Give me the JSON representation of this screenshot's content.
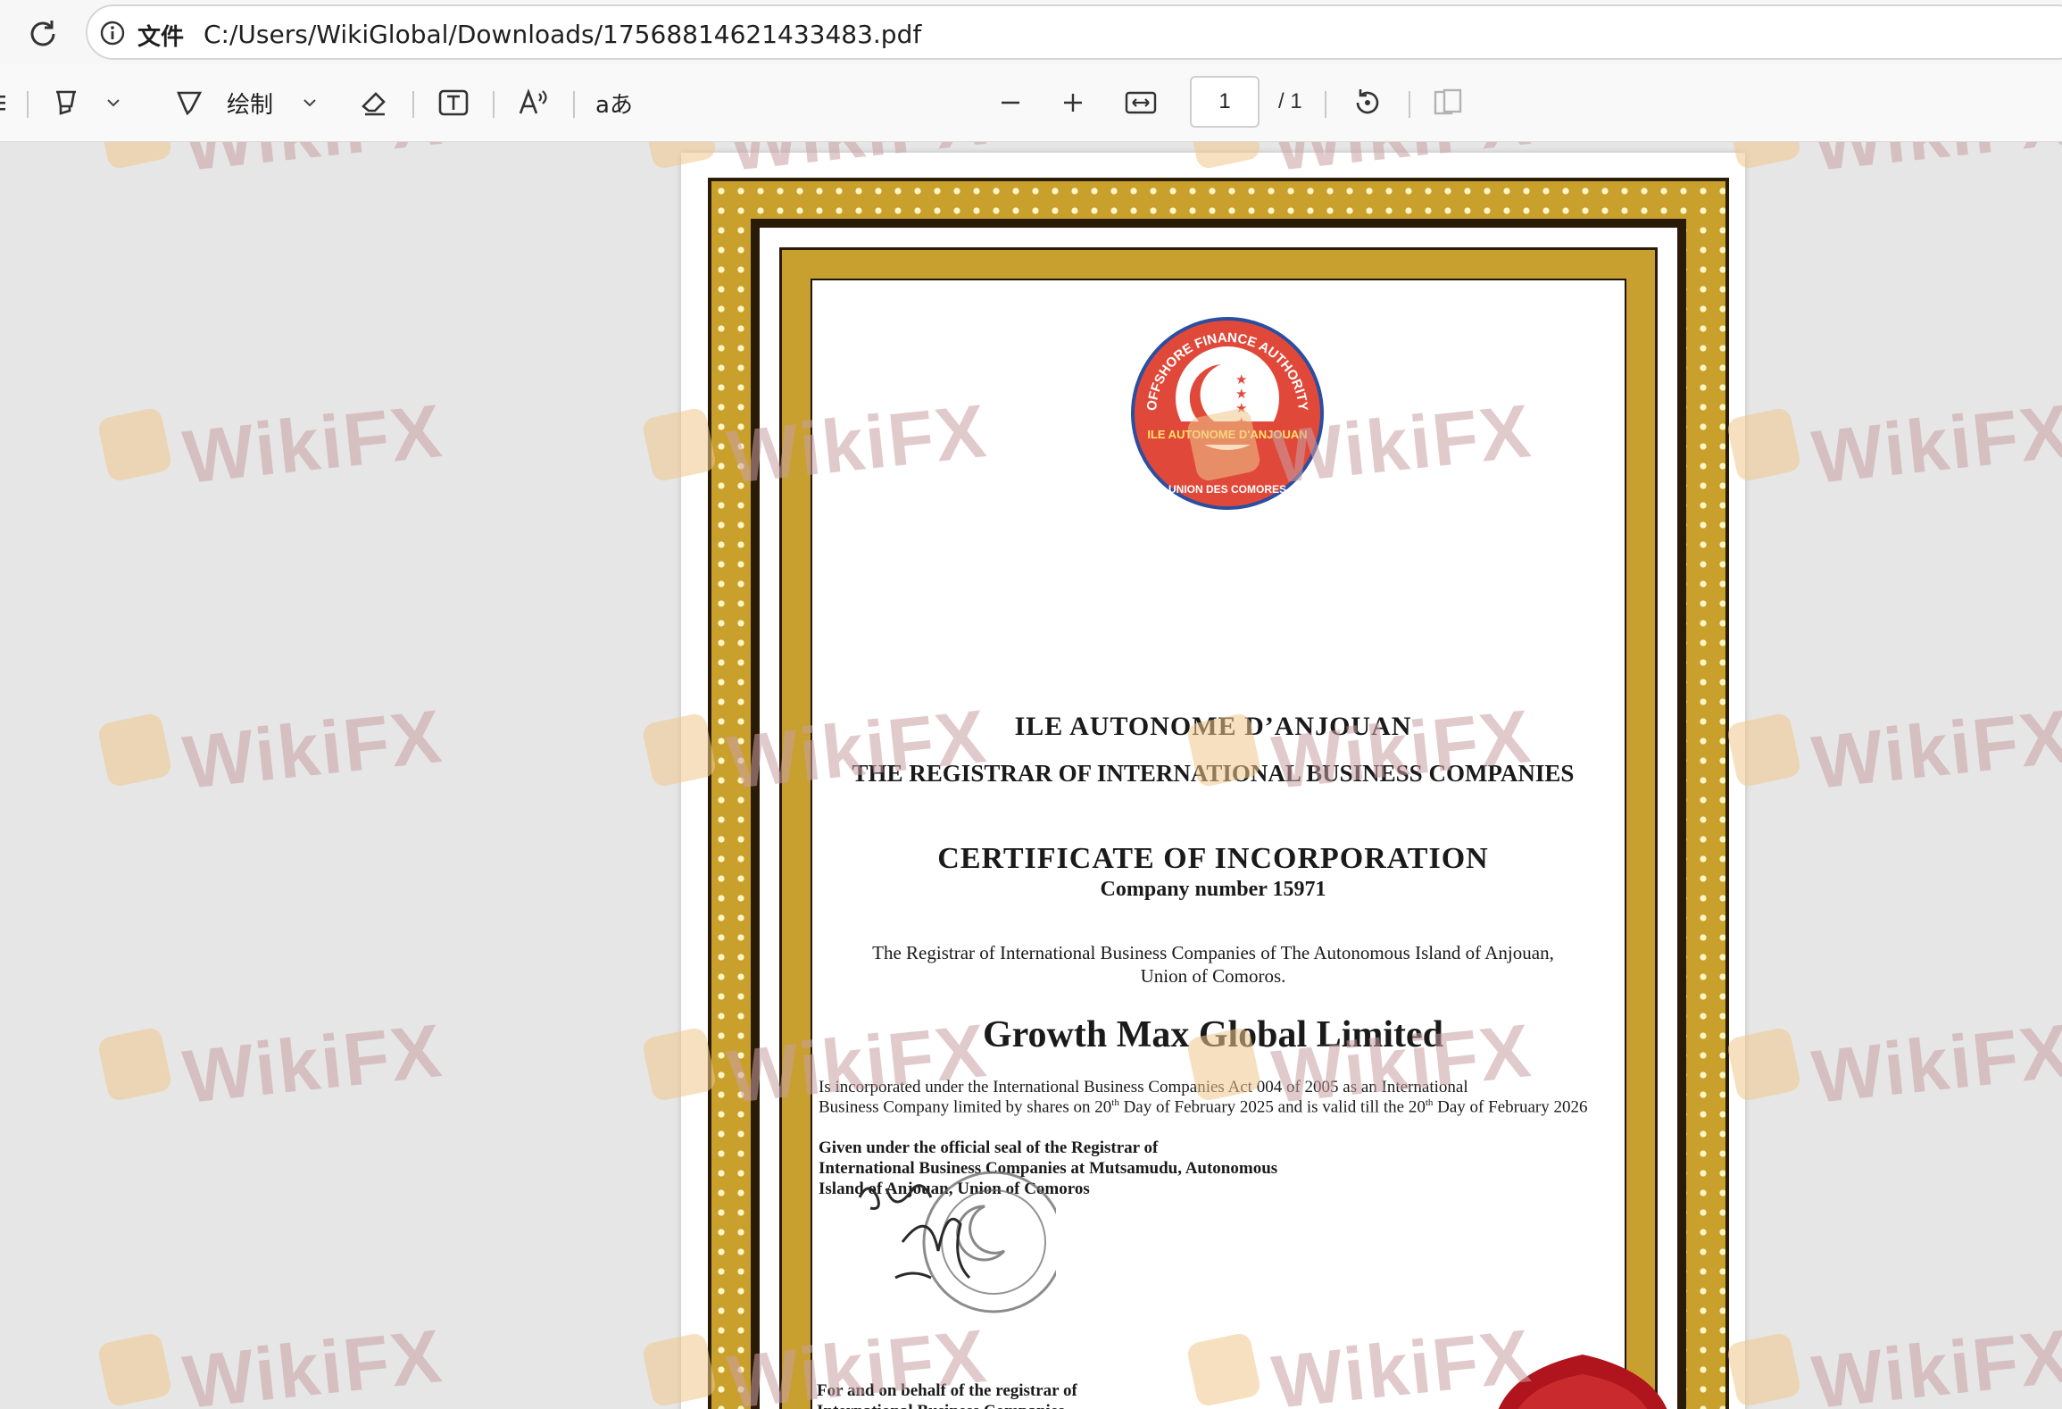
{
  "address_bar": {
    "site_label": "文件",
    "url": "C:/Users/WikiGlobal/Downloads/17568814621433483.pdf"
  },
  "toolbar": {
    "draw_label": "绘制",
    "translate_glyph": "aあ",
    "page_current": "1",
    "page_total": "/ 1"
  },
  "certificate": {
    "seal_top_text": "OFFSHORE FINANCE AUTHORITY",
    "seal_band_text": "ILE AUTONOME D'ANJOUAN",
    "seal_bottom_text": "UNION DES COMORES",
    "issuer": "ILE AUTONOME D’ANJOUAN",
    "registrar": "THE REGISTRAR OF INTERNATIONAL BUSINESS COMPANIES",
    "title": "CERTIFICATE OF INCORPORATION",
    "company_number": "Company number 15971",
    "intro_line1": "The Registrar of International Business Companies of The Autonomous Island of Anjouan,",
    "intro_line2": "Union of Comoros.",
    "company_name": "Growth Max Global Limited",
    "body_line1": "Is incorporated under the International Business Companies Act 004 of 2005 as an International",
    "body_line2a": "Business Company limited by shares on 20",
    "body_sup1": "th",
    "body_line2b": " Day of February 2025 and is valid till the 20",
    "body_sup2": "th",
    "body_line2c": " Day of February 2026",
    "given_line1": "Given under the official seal of the Registrar of",
    "given_line2": "International Business Companies at Mutsamudu, Autonomous",
    "given_line3": "Island of Anjouan, Union of Comoros",
    "behalf_line1": "For and on behalf of the registrar of",
    "behalf_line2": "International Business Companies"
  },
  "watermark": {
    "text": "WikiFX"
  },
  "colors": {
    "seal_red": "#e0493a",
    "seal_blue": "#2a4ea0",
    "gold": "#c9a02c",
    "wax_red": "#b0141c"
  }
}
